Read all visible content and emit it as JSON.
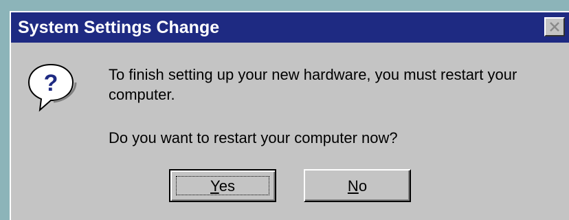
{
  "dialog": {
    "title": "System Settings Change",
    "icon": "question-icon",
    "message": "To finish setting up your new hardware, you must restart your computer.",
    "question": "Do you want to restart your computer now?",
    "buttons": {
      "yes": {
        "mnemonic": "Y",
        "rest": "es"
      },
      "no": {
        "mnemonic": "N",
        "rest": "o"
      }
    }
  },
  "colors": {
    "titlebar": "#1e2a82",
    "dialog_face": "#c4c4c4",
    "desktop": "#8cb4b9"
  }
}
